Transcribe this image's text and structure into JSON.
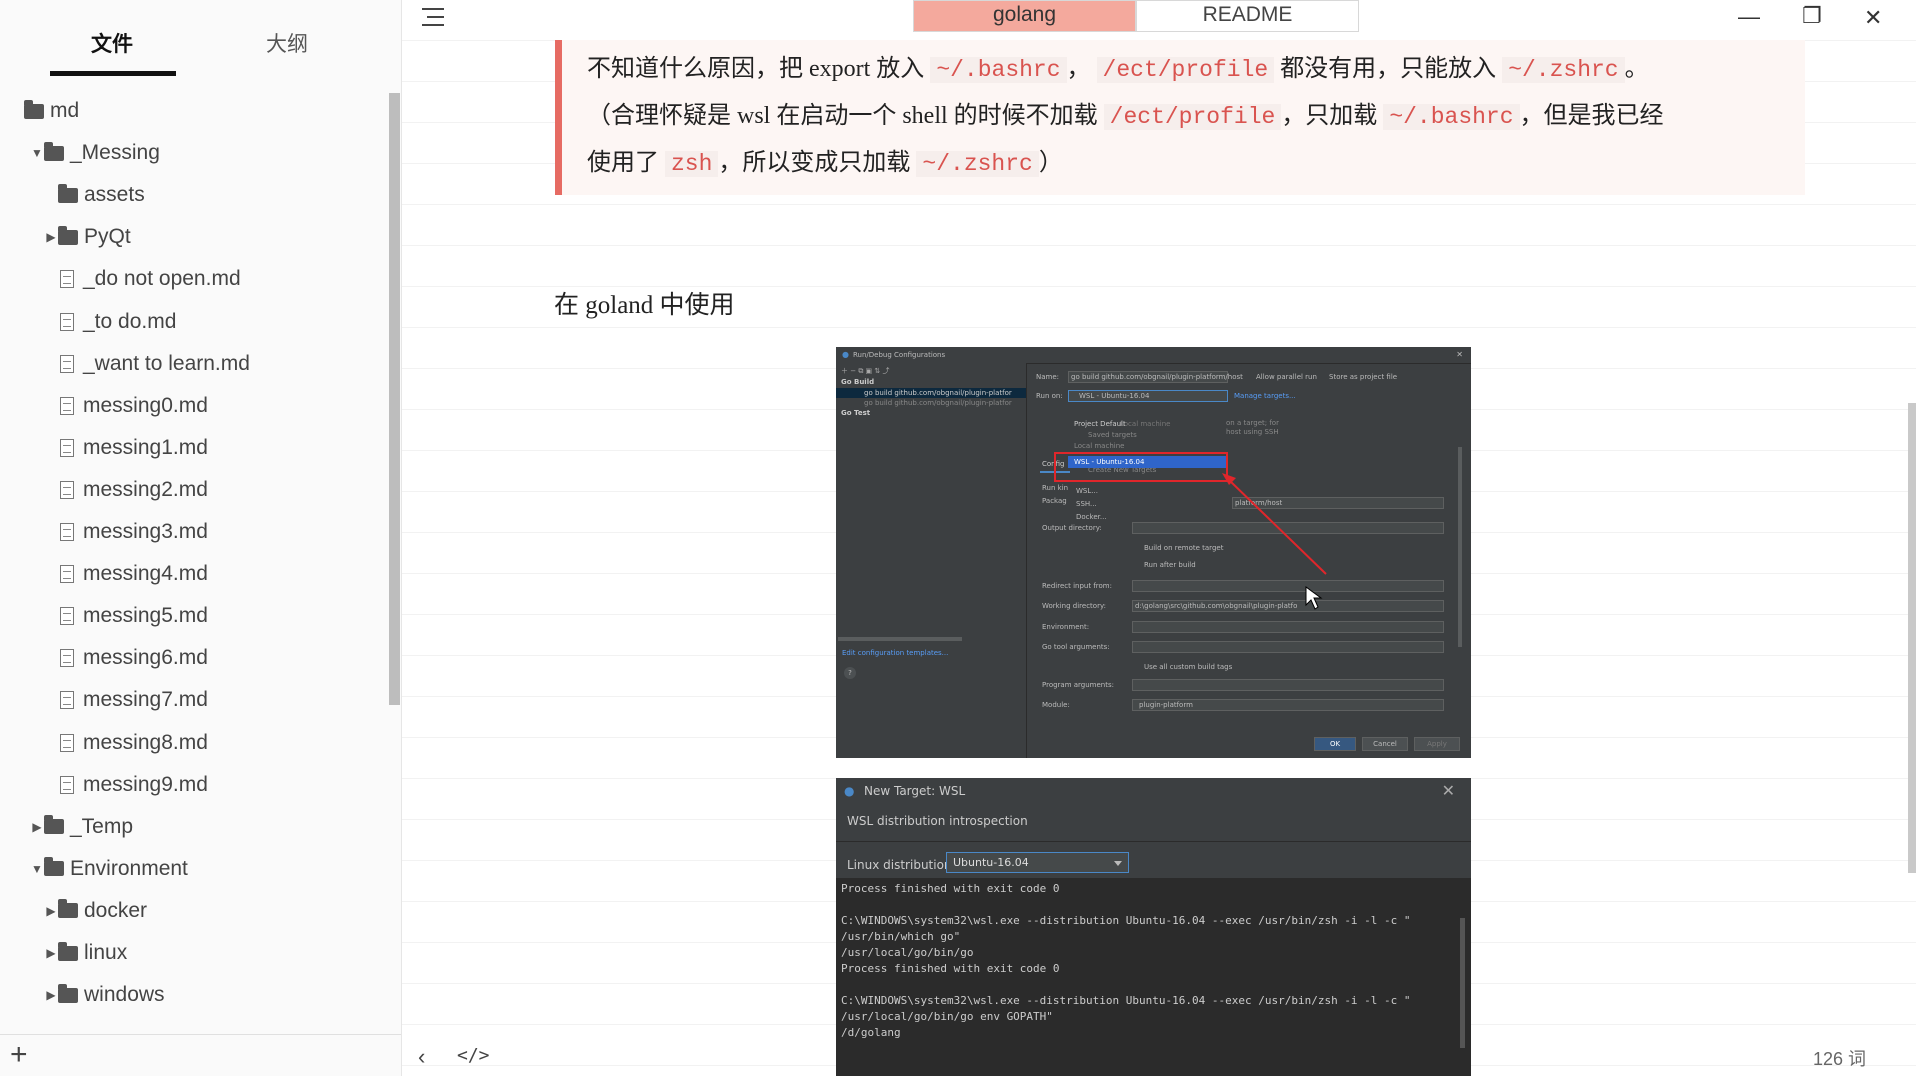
{
  "sidebar": {
    "tabs": {
      "files": "文件",
      "outline": "大纲"
    },
    "tree": [
      {
        "kind": "folder",
        "label": "md",
        "expanded": null
      },
      {
        "kind": "folder",
        "label": "_Messing",
        "expanded": true
      },
      {
        "kind": "folder",
        "label": "assets",
        "expanded": null
      },
      {
        "kind": "folder",
        "label": "PyQt",
        "expanded": false
      },
      {
        "kind": "file",
        "label": "_do not open.md"
      },
      {
        "kind": "file",
        "label": "_to do.md"
      },
      {
        "kind": "file",
        "label": "_want to learn.md"
      },
      {
        "kind": "file",
        "label": "messing0.md"
      },
      {
        "kind": "file",
        "label": "messing1.md"
      },
      {
        "kind": "file",
        "label": "messing2.md"
      },
      {
        "kind": "file",
        "label": "messing3.md"
      },
      {
        "kind": "file",
        "label": "messing4.md"
      },
      {
        "kind": "file",
        "label": "messing5.md"
      },
      {
        "kind": "file",
        "label": "messing6.md"
      },
      {
        "kind": "file",
        "label": "messing7.md"
      },
      {
        "kind": "file",
        "label": "messing8.md"
      },
      {
        "kind": "file",
        "label": "messing9.md"
      },
      {
        "kind": "folder",
        "label": "_Temp",
        "expanded": false
      },
      {
        "kind": "folder",
        "label": "Environment",
        "expanded": true
      },
      {
        "kind": "folder",
        "label": "docker",
        "expanded": false
      },
      {
        "kind": "folder",
        "label": "linux",
        "expanded": false
      },
      {
        "kind": "folder",
        "label": "windows",
        "expanded": false
      }
    ],
    "add_label": "+"
  },
  "tabs": {
    "active": "golang",
    "other": "README"
  },
  "window": {
    "minimize": "—",
    "restore": "❐",
    "close": "✕"
  },
  "quote": {
    "l1": {
      "a": "不知道什么原因，把 export 放入 ",
      "c1": "~/.bashrc",
      "b": "， ",
      "c2": "/ect/profile",
      "d": " 都没有用，只能放入 ",
      "c3": "~/.zshrc",
      "e": "。"
    },
    "l2": {
      "a": "（合理怀疑是 wsl 在启动一个 shell 的时候不加载 ",
      "c1": "/ect/profile",
      "b": "，只加载 ",
      "c2": "~/.bashrc",
      "d": "，但是我已经"
    },
    "l3": {
      "a": "使用了 ",
      "c1": "zsh",
      "b": "，所以变成只加载 ",
      "c2": "~/.zshrc",
      "d": "）"
    }
  },
  "heading": "在 goland 中使用",
  "shot1": {
    "title": "Run/Debug Configurations",
    "tree_go_build": "Go Build",
    "tree_item1": "go build github.com/obgnail/plugin-platfor",
    "tree_item2": "go build github.com/obgnail/plugin-platfor",
    "tree_go_test": "Go Test",
    "name_label": "Name:",
    "name_value": "go build github.com/obgnail/plugin-platform/host",
    "allow_parallel": "Allow parallel run",
    "store_as_file": "Store as project file",
    "run_on_label": "Run on:",
    "run_on_value": "WSL - Ubuntu-16.04",
    "manage_targets": "Manage targets...",
    "project_default": "Project Default",
    "local_machine_hint": "Local machine",
    "saved_targets": "Saved targets",
    "local_machine": "Local machine",
    "wsl_selected": "WSL - Ubuntu-16.04",
    "create_new_targets": "Create New Targets",
    "wsl": "WSL...",
    "ssh": "SSH...",
    "docker": "Docker...",
    "hint_target": "on a target; for",
    "hint_ssh": "host using SSH",
    "config_tab": "Config",
    "run_kind": "Run kin",
    "package": "Packag",
    "package_value": "platform/host",
    "output_dir": "Output directory:",
    "build_remote": "Build on remote target",
    "run_after_build": "Run after build",
    "redirect_input": "Redirect input from:",
    "working_dir": "Working directory:",
    "working_dir_value": "d:\\golang\\src\\github.com\\obgnail\\plugin-platfo",
    "environment": "Environment:",
    "go_tool_args": "Go tool arguments:",
    "use_custom_tags": "Use all custom build tags",
    "program_args": "Program arguments:",
    "module": "Module:",
    "module_value": "plugin-platform",
    "edit_templates": "Edit configuration templates...",
    "help": "?",
    "ok": "OK",
    "cancel": "Cancel",
    "apply": "Apply"
  },
  "shot2": {
    "title": "New Target: WSL",
    "close": "✕",
    "subtitle": "WSL distribution introspection",
    "distro_label": "Linux distribution:",
    "distro_value": "Ubuntu-16.04",
    "console": [
      "Process finished with exit code 0",
      "",
      "C:\\WINDOWS\\system32\\wsl.exe --distribution Ubuntu-16.04 --exec /usr/bin/zsh -i -l -c \"",
      "/usr/bin/which go\"",
      "/usr/local/go/bin/go",
      "Process finished with exit code 0",
      "",
      "C:\\WINDOWS\\system32\\wsl.exe --distribution Ubuntu-16.04 --exec /usr/bin/zsh -i -l -c \"",
      "/usr/local/go/bin/go env GOPATH\"",
      "/d/golang"
    ]
  },
  "footer": {
    "back": "‹",
    "source": "</>",
    "word_count": "126 词"
  },
  "colors": {
    "accent_tab": "#f4a99d",
    "quote_border": "#e66b63",
    "code_text": "#d9534f"
  }
}
